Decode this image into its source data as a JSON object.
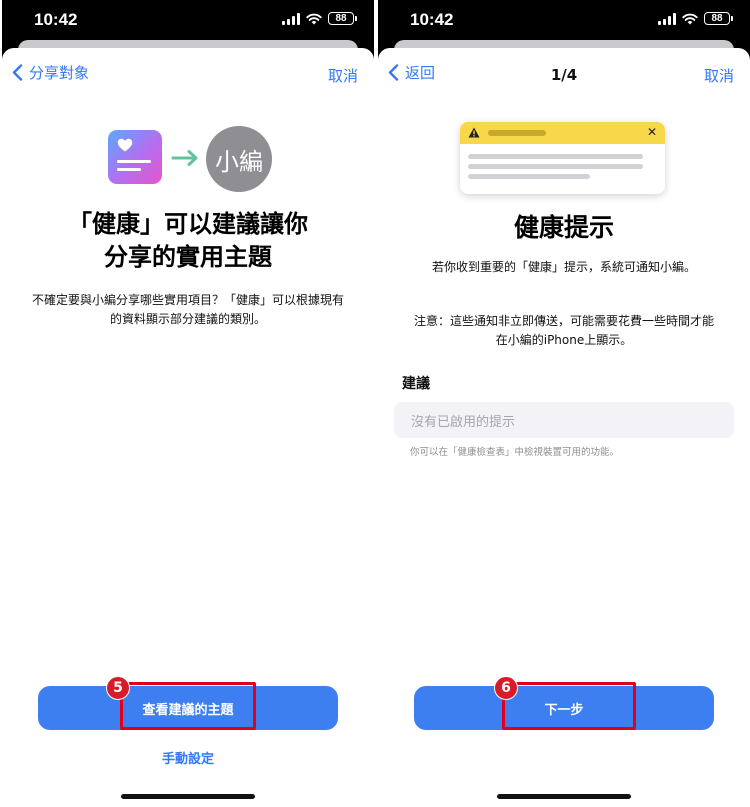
{
  "status_bar": {
    "time": "10:42",
    "battery": "88"
  },
  "left": {
    "nav": {
      "back": "分享對象",
      "cancel": "取消"
    },
    "avatar_text": "小編",
    "headline_line1": "「健康」可以建議讓你",
    "headline_line2": "分享的實用主題",
    "description": "不確定要與小編分享哪些實用項目？「健康」可以根據現有的資料顯示部分建議的類別。",
    "primary_button": "查看建議的主題",
    "secondary_button": "手動設定",
    "step_badge": "5"
  },
  "right": {
    "nav": {
      "back": "返回",
      "title": "1/4",
      "cancel": "取消"
    },
    "title": "健康提示",
    "paragraph1": "若你收到重要的「健康」提示，系統可通知小編。",
    "paragraph2": "注意：這些通知非立即傳送，可能需要花費一些時間才能在小編的iPhone上顯示。",
    "section_header": "建議",
    "empty_state": "沒有已啟用的提示",
    "footnote": "你可以在「健康檢查表」中檢視裝置可用的功能。",
    "primary_button": "下一步",
    "step_badge": "6"
  },
  "colors": {
    "accent": "#3478f6",
    "button": "#3d7ff0",
    "highlight": "#e0001b",
    "badge": "#d81b2a",
    "notification_yellow": "#f6d84a"
  },
  "icons": [
    "chevron-left-icon",
    "health-app-icon",
    "arrow-right-icon",
    "warning-icon",
    "close-icon",
    "cellular-signal-icon",
    "wifi-icon",
    "battery-icon"
  ]
}
